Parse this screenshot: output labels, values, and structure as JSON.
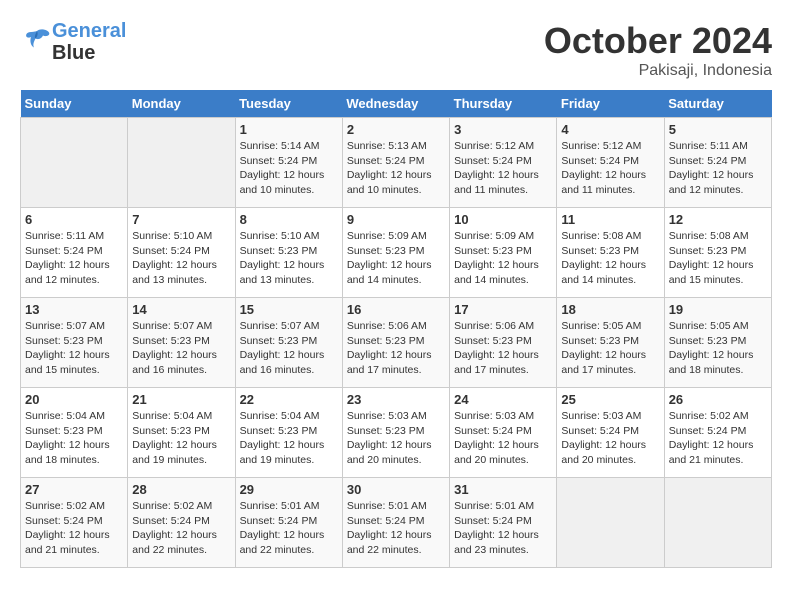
{
  "header": {
    "logo_line1": "General",
    "logo_line2": "Blue",
    "month": "October 2024",
    "location": "Pakisaji, Indonesia"
  },
  "weekdays": [
    "Sunday",
    "Monday",
    "Tuesday",
    "Wednesday",
    "Thursday",
    "Friday",
    "Saturday"
  ],
  "weeks": [
    [
      {
        "day": "",
        "info": ""
      },
      {
        "day": "",
        "info": ""
      },
      {
        "day": "1",
        "info": "Sunrise: 5:14 AM\nSunset: 5:24 PM\nDaylight: 12 hours\nand 10 minutes."
      },
      {
        "day": "2",
        "info": "Sunrise: 5:13 AM\nSunset: 5:24 PM\nDaylight: 12 hours\nand 10 minutes."
      },
      {
        "day": "3",
        "info": "Sunrise: 5:12 AM\nSunset: 5:24 PM\nDaylight: 12 hours\nand 11 minutes."
      },
      {
        "day": "4",
        "info": "Sunrise: 5:12 AM\nSunset: 5:24 PM\nDaylight: 12 hours\nand 11 minutes."
      },
      {
        "day": "5",
        "info": "Sunrise: 5:11 AM\nSunset: 5:24 PM\nDaylight: 12 hours\nand 12 minutes."
      }
    ],
    [
      {
        "day": "6",
        "info": "Sunrise: 5:11 AM\nSunset: 5:24 PM\nDaylight: 12 hours\nand 12 minutes."
      },
      {
        "day": "7",
        "info": "Sunrise: 5:10 AM\nSunset: 5:24 PM\nDaylight: 12 hours\nand 13 minutes."
      },
      {
        "day": "8",
        "info": "Sunrise: 5:10 AM\nSunset: 5:23 PM\nDaylight: 12 hours\nand 13 minutes."
      },
      {
        "day": "9",
        "info": "Sunrise: 5:09 AM\nSunset: 5:23 PM\nDaylight: 12 hours\nand 14 minutes."
      },
      {
        "day": "10",
        "info": "Sunrise: 5:09 AM\nSunset: 5:23 PM\nDaylight: 12 hours\nand 14 minutes."
      },
      {
        "day": "11",
        "info": "Sunrise: 5:08 AM\nSunset: 5:23 PM\nDaylight: 12 hours\nand 14 minutes."
      },
      {
        "day": "12",
        "info": "Sunrise: 5:08 AM\nSunset: 5:23 PM\nDaylight: 12 hours\nand 15 minutes."
      }
    ],
    [
      {
        "day": "13",
        "info": "Sunrise: 5:07 AM\nSunset: 5:23 PM\nDaylight: 12 hours\nand 15 minutes."
      },
      {
        "day": "14",
        "info": "Sunrise: 5:07 AM\nSunset: 5:23 PM\nDaylight: 12 hours\nand 16 minutes."
      },
      {
        "day": "15",
        "info": "Sunrise: 5:07 AM\nSunset: 5:23 PM\nDaylight: 12 hours\nand 16 minutes."
      },
      {
        "day": "16",
        "info": "Sunrise: 5:06 AM\nSunset: 5:23 PM\nDaylight: 12 hours\nand 17 minutes."
      },
      {
        "day": "17",
        "info": "Sunrise: 5:06 AM\nSunset: 5:23 PM\nDaylight: 12 hours\nand 17 minutes."
      },
      {
        "day": "18",
        "info": "Sunrise: 5:05 AM\nSunset: 5:23 PM\nDaylight: 12 hours\nand 17 minutes."
      },
      {
        "day": "19",
        "info": "Sunrise: 5:05 AM\nSunset: 5:23 PM\nDaylight: 12 hours\nand 18 minutes."
      }
    ],
    [
      {
        "day": "20",
        "info": "Sunrise: 5:04 AM\nSunset: 5:23 PM\nDaylight: 12 hours\nand 18 minutes."
      },
      {
        "day": "21",
        "info": "Sunrise: 5:04 AM\nSunset: 5:23 PM\nDaylight: 12 hours\nand 19 minutes."
      },
      {
        "day": "22",
        "info": "Sunrise: 5:04 AM\nSunset: 5:23 PM\nDaylight: 12 hours\nand 19 minutes."
      },
      {
        "day": "23",
        "info": "Sunrise: 5:03 AM\nSunset: 5:23 PM\nDaylight: 12 hours\nand 20 minutes."
      },
      {
        "day": "24",
        "info": "Sunrise: 5:03 AM\nSunset: 5:24 PM\nDaylight: 12 hours\nand 20 minutes."
      },
      {
        "day": "25",
        "info": "Sunrise: 5:03 AM\nSunset: 5:24 PM\nDaylight: 12 hours\nand 20 minutes."
      },
      {
        "day": "26",
        "info": "Sunrise: 5:02 AM\nSunset: 5:24 PM\nDaylight: 12 hours\nand 21 minutes."
      }
    ],
    [
      {
        "day": "27",
        "info": "Sunrise: 5:02 AM\nSunset: 5:24 PM\nDaylight: 12 hours\nand 21 minutes."
      },
      {
        "day": "28",
        "info": "Sunrise: 5:02 AM\nSunset: 5:24 PM\nDaylight: 12 hours\nand 22 minutes."
      },
      {
        "day": "29",
        "info": "Sunrise: 5:01 AM\nSunset: 5:24 PM\nDaylight: 12 hours\nand 22 minutes."
      },
      {
        "day": "30",
        "info": "Sunrise: 5:01 AM\nSunset: 5:24 PM\nDaylight: 12 hours\nand 22 minutes."
      },
      {
        "day": "31",
        "info": "Sunrise: 5:01 AM\nSunset: 5:24 PM\nDaylight: 12 hours\nand 23 minutes."
      },
      {
        "day": "",
        "info": ""
      },
      {
        "day": "",
        "info": ""
      }
    ]
  ]
}
